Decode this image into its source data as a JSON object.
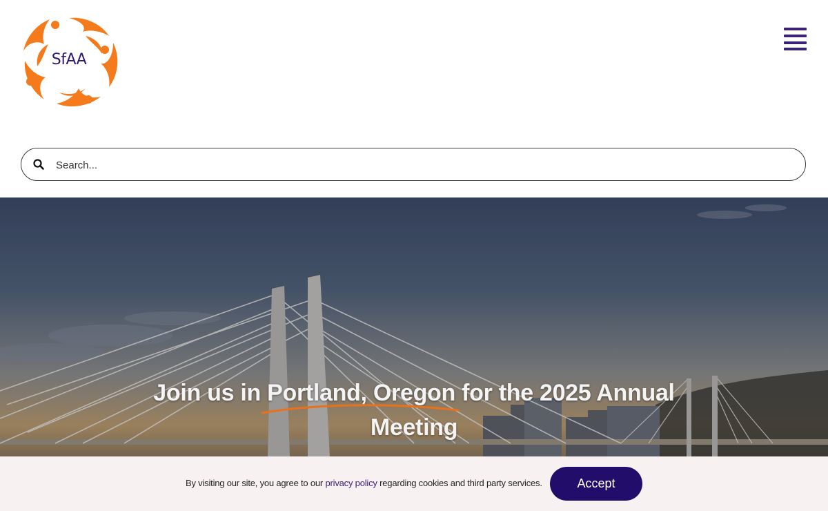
{
  "logo": {
    "text": "SfAA",
    "orange": "#f47a1c",
    "purple": "#2b1a6e"
  },
  "menu": {
    "icon": "hamburger-menu-icon",
    "color": "#3b2178"
  },
  "search": {
    "placeholder": "Search...",
    "value": "",
    "icon": "search-icon"
  },
  "hero": {
    "title_line1": "Join us in Portland, Oregon for the 2025 Annual",
    "title_line2": "Meeting",
    "accent_color": "#e8721c"
  },
  "cookie": {
    "text_before": "By visiting our site, you agree to our ",
    "link_text": "privacy policy",
    "text_after": " regarding cookies and third party services.",
    "accept_label": "Accept",
    "button_color": "#220e6a"
  }
}
